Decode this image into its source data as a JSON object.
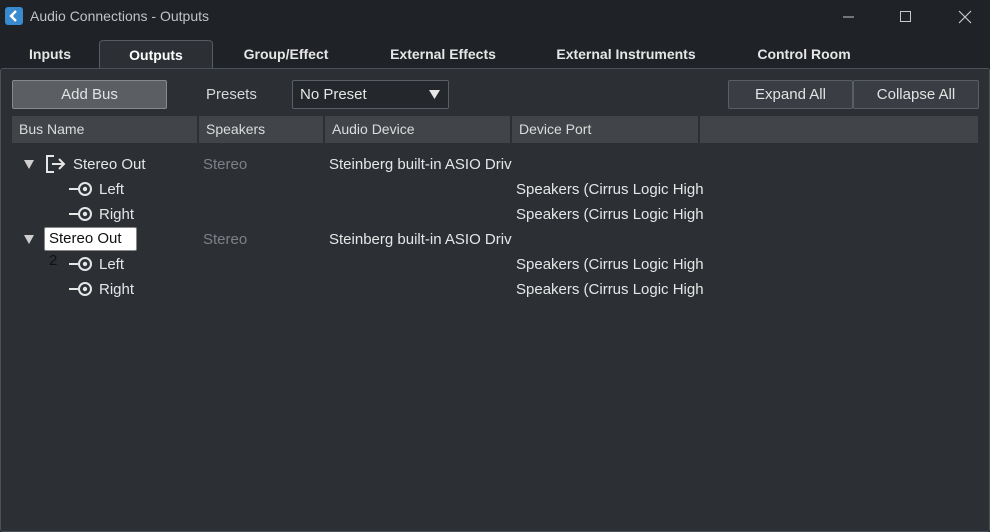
{
  "window": {
    "title": "Audio Connections - Outputs"
  },
  "tabs": [
    {
      "label": "Inputs",
      "active": false
    },
    {
      "label": "Outputs",
      "active": true
    },
    {
      "label": "Group/Effect",
      "active": false
    },
    {
      "label": "External Effects",
      "active": false
    },
    {
      "label": "External Instruments",
      "active": false
    },
    {
      "label": "Control Room",
      "active": false
    }
  ],
  "toolbar": {
    "add_bus_label": "Add Bus",
    "presets_label": "Presets",
    "preset_value": "No Preset",
    "expand_all_label": "Expand All",
    "collapse_all_label": "Collapse All"
  },
  "columns": [
    "Bus Name",
    "Speakers",
    "Audio Device",
    "Device Port"
  ],
  "buses": [
    {
      "name": "Stereo Out",
      "speakers": "Stereo",
      "device": "Steinberg built-in ASIO Driv",
      "channels": [
        {
          "name": "Left",
          "port": "Speakers (Cirrus Logic High"
        },
        {
          "name": "Right",
          "port": "Speakers (Cirrus Logic High"
        }
      ]
    },
    {
      "name": "Stereo Out 2",
      "speakers": "Stereo",
      "device": "Steinberg built-in ASIO Driv",
      "channels": [
        {
          "name": "Left",
          "port": "Speakers (Cirrus Logic High"
        },
        {
          "name": "Right",
          "port": "Speakers (Cirrus Logic High"
        }
      ]
    }
  ],
  "colors": {
    "accent": "#3a8ad0",
    "panel": "#2c3035",
    "background": "#1f2226"
  }
}
